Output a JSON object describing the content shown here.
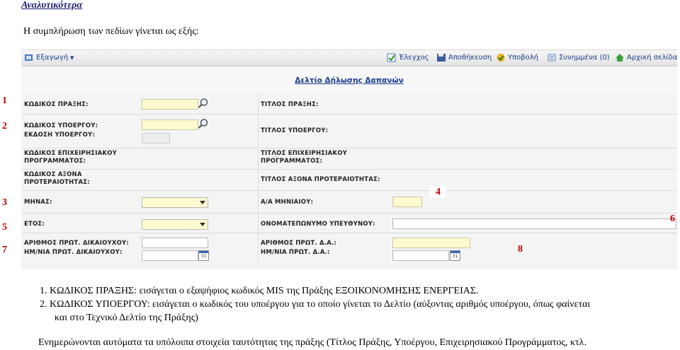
{
  "heading": "Αναλυτικότερα",
  "intro": "Η συμπλήρωση των πεδίων γίνεται ως εξής:",
  "markers": [
    "1",
    "2",
    "3",
    "4",
    "5",
    "6",
    "7",
    "8"
  ],
  "toolbar": {
    "export_label": "Εξαγωγή",
    "check_label": "Έλεγχος",
    "save_label": "Αποθήκευση",
    "submit_label": "Υποβολή",
    "faq_label": "Συνημμένα (0)",
    "home_label": "Αρχική σελίδα"
  },
  "form": {
    "title": "Δελτίο Δήλωσης Δαπανών",
    "action_code": "ΚΩΔΙΚΟΣ ΠΡΑΞΗΣ:",
    "action_title": "ΤΙΤΛΟΣ ΠΡΑΞΗΣ:",
    "subproject_code": "ΚΩΔΙΚΟΣ ΥΠΟΕΡΓΟΥ:",
    "subproject_version": "ΕΚΔΟΣΗ ΥΠΟΕΡΓΟΥ:",
    "subproject_title": "ΤΙΤΛΟΣ ΥΠΟΕΡΓΟΥ:",
    "op_code_1": "ΚΩΔΙΚΟΣ ΕΠΙΧΕΙΡΗΣΙΑΚΟΥ",
    "op_code_2": "ΠΡΟΓΡΑΜΜΑΤΟΣ:",
    "op_title_1": "ΤΙΤΛΟΣ ΕΠΙΧΕΙΡΗΣΙΑΚΟΥ",
    "op_title_2": "ΠΡΟΓΡΑΜΜΑΤΟΣ:",
    "axis_code_1": "ΚΩΔΙΚΟΣ ΑΞΟΝΑ",
    "axis_code_2": "ΠΡΟΤΕΡΑΙΟΤΗΤΑΣ:",
    "axis_title": "ΤΙΤΛΟΣ ΑΞΟΝΑ ΠΡΟΤΕΡΑΙΟΤΗΤΑΣ:",
    "month": "ΜΗΝΑΣ:",
    "monthly_no": "Α/Α ΜΗΝΙΑΙΟΥ:",
    "year": "ΕΤΟΣ:",
    "responsible": "ΟΝΟΜΑΤΕΠΩΝΥΜΟ ΥΠΕΥΘΥΝΟΥ:",
    "benef_no": "ΑΡΙΘΜΟΣ ΠΡΩΤ. ΔΙΚΑΙΟΥΧΟΥ:",
    "benef_date": "ΗΜ/ΝΙΑ ΠΡΩΤ. ΔΙΚΑΙΟΥΧΟΥ:",
    "da_no": "ΑΡΙΘΜΟΣ ΠΡΩΤ. Δ.Α.:",
    "da_date": "ΗΜ/ΝΙΑ ΠΡΩΤ. Δ.Α.:",
    "cal_text": "31"
  },
  "notes": {
    "n1": "1.  ΚΩΔΙΚΟΣ ΠΡΑΞΗΣ: εισάγεται ο εξαψήφιος κωδικός MIS της Πράξης ΕΞΟΙΚΟΝΟΜΗΣΗΣ ΕΝΕΡΓΕΙΑΣ.",
    "n2a": "2.  ΚΩΔΙΚΟΣ ΥΠΟΕΡΓΟΥ: εισάγεται ο κωδικός του υποέργου για το οποίο γίνεται το Δελτίο (αύξοντας αριθμός υποέργου, όπως φαίνεται",
    "n2b": "και στο Τεχνικό Δελτίο της Πράξης)",
    "n3": "Ενημερώνονται αυτόματα τα υπόλοιπα στοιχεία ταυτότητας της πράξης (Τίτλος Πράξης, Υποέργου, Επιχειρησιακού Προγράμματος, κτλ."
  }
}
